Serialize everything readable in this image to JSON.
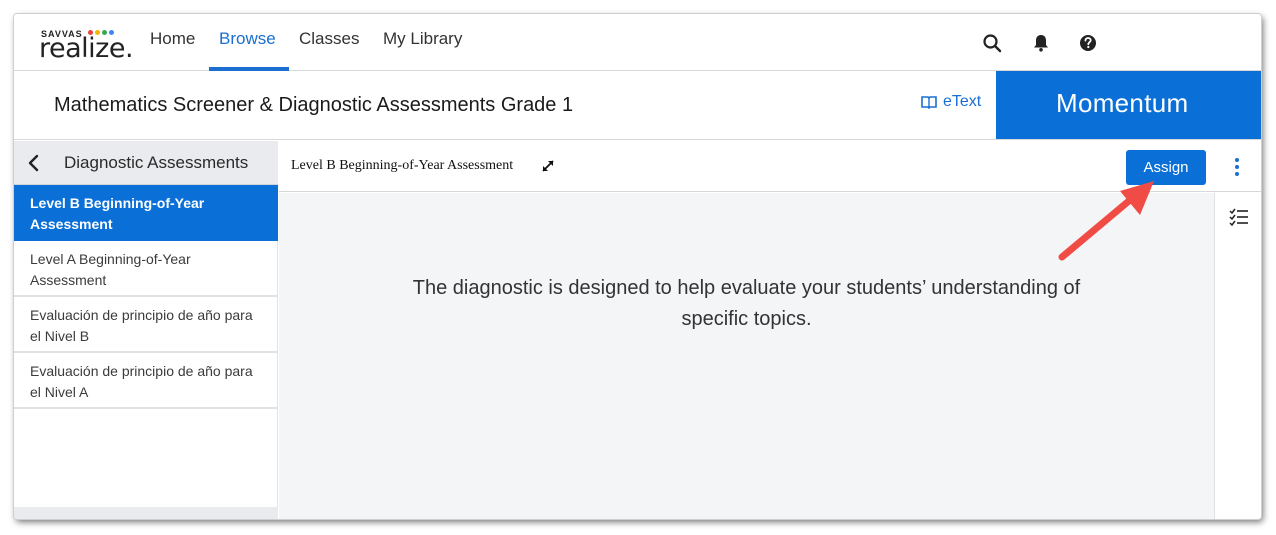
{
  "nav": {
    "logo_top": "SAVVAS",
    "logo_main": "realize.",
    "links": [
      "Home",
      "Browse",
      "Classes",
      "My Library"
    ],
    "active": "Browse"
  },
  "header": {
    "program_title": "Mathematics Screener & Diagnostic Assessments Grade 1",
    "etext_label": "eText",
    "brand_label": "Momentum"
  },
  "sidebar": {
    "title": "Diagnostic Assessments",
    "items": [
      {
        "label": "Level B Beginning-of-Year Assessment",
        "active": true
      },
      {
        "label": "Level A Beginning-of-Year Assessment",
        "active": false
      },
      {
        "label": "Evaluación de principio de año para el Nivel B",
        "active": false
      },
      {
        "label": "Evaluación de principio de año para el Nivel A",
        "active": false
      }
    ]
  },
  "content": {
    "title": "Level B Beginning-of-Year Assessment",
    "assign_label": "Assign",
    "message": "The diagnostic is designed to help evaluate your students’ understanding of specific topics."
  },
  "colors": {
    "accent": "#0a6fd6",
    "arrow": "#f04b45"
  }
}
